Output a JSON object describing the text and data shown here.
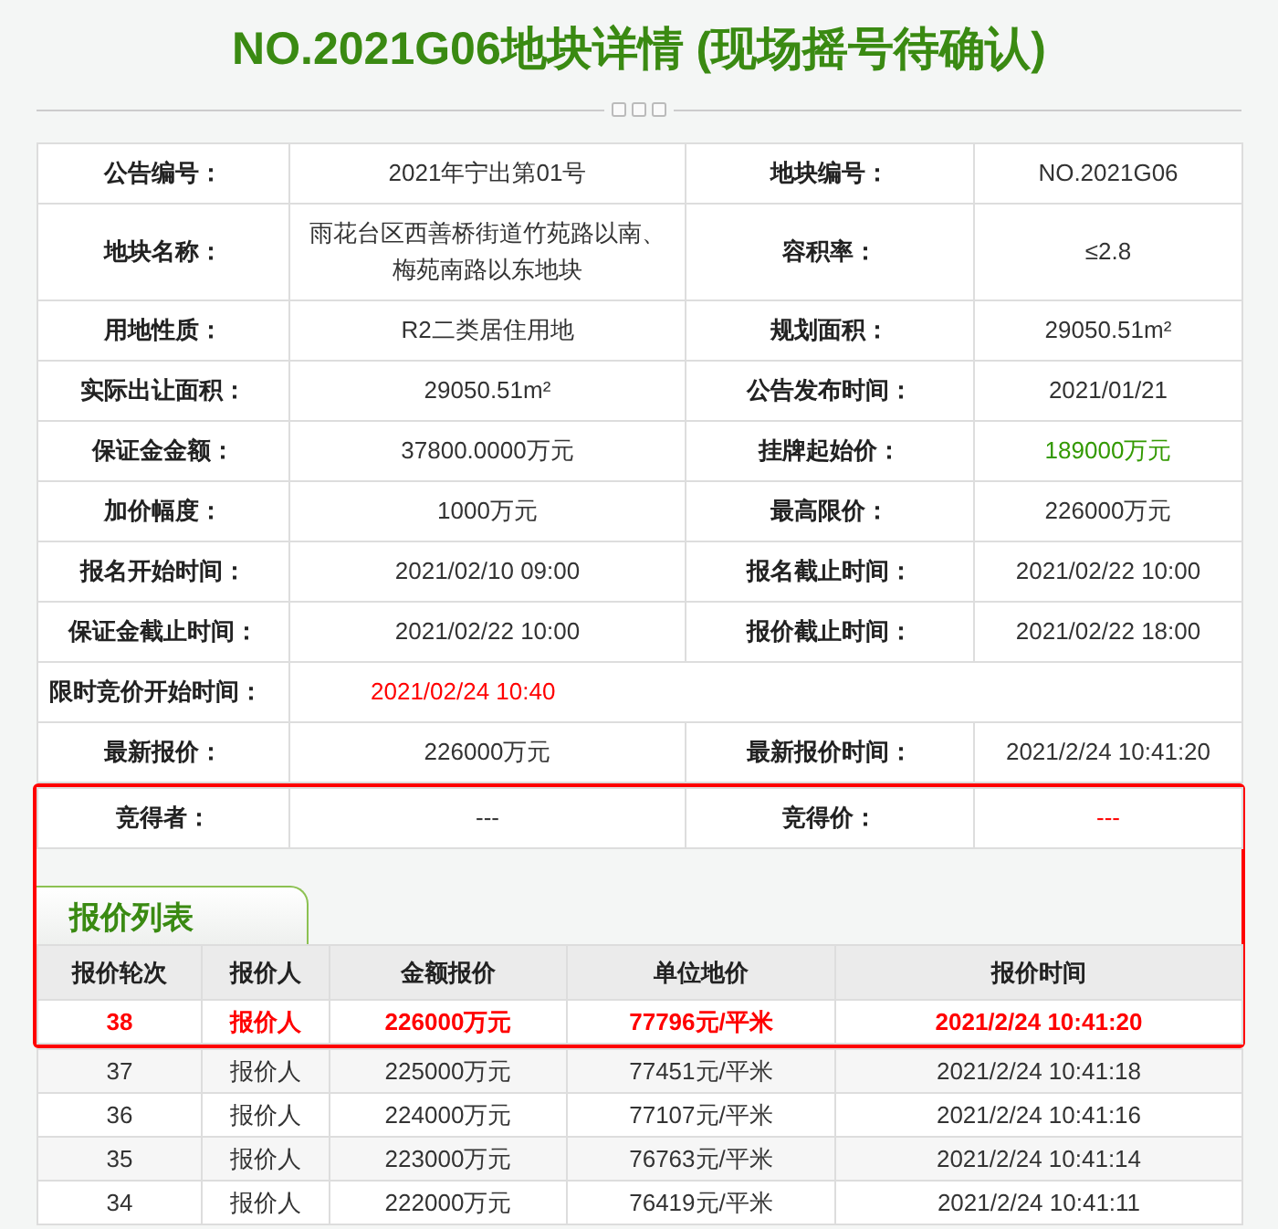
{
  "title": "NO.2021G06地块详情 (现场摇号待确认)",
  "details": [
    {
      "cells": [
        {
          "label": "公告编号：",
          "value": "2021年宁出第01号"
        },
        {
          "label": "地块编号：",
          "value": "NO.2021G06"
        }
      ]
    },
    {
      "cells": [
        {
          "label": "地块名称：",
          "value": "雨花台区西善桥街道竹苑路以南、梅苑南路以东地块"
        },
        {
          "label": "容积率：",
          "value": "≤2.8"
        }
      ]
    },
    {
      "cells": [
        {
          "label": "用地性质：",
          "value": "R2二类居住用地"
        },
        {
          "label": "规划面积：",
          "value": "29050.51m²"
        }
      ]
    },
    {
      "cells": [
        {
          "label": "实际出让面积：",
          "value": "29050.51m²"
        },
        {
          "label": "公告发布时间：",
          "value": "2021/01/21"
        }
      ]
    },
    {
      "cells": [
        {
          "label": "保证金金额：",
          "value": "37800.0000万元"
        },
        {
          "label": "挂牌起始价：",
          "value": "189000万元",
          "color": "#339900"
        }
      ]
    },
    {
      "cells": [
        {
          "label": "加价幅度：",
          "value": "1000万元"
        },
        {
          "label": "最高限价：",
          "value": "226000万元"
        }
      ]
    },
    {
      "cells": [
        {
          "label": "报名开始时间：",
          "value": "2021/02/10 09:00"
        },
        {
          "label": "报名截止时间：",
          "value": "2021/02/22 10:00"
        }
      ]
    },
    {
      "cells": [
        {
          "label": "保证金截止时间：",
          "value": "2021/02/22 10:00"
        },
        {
          "label": "报价截止时间：",
          "value": "2021/02/22 18:00"
        }
      ]
    },
    {
      "cells": [
        {
          "label": "限时竞价开始时间：",
          "value": "2021/02/24 10:40",
          "color": "#ff0000"
        }
      ]
    },
    {
      "cells": [
        {
          "label": "最新报价：",
          "value": "226000万元"
        },
        {
          "label": "最新报价时间：",
          "value": "2021/2/24 10:41:20"
        }
      ]
    }
  ],
  "result": {
    "cells": [
      {
        "label": "竞得者：",
        "value": "---"
      },
      {
        "label": "竞得价：",
        "value": "---",
        "color": "#ff0000"
      }
    ]
  },
  "bids": {
    "tab": "报价列表",
    "columns": [
      "报价轮次",
      "报价人",
      "金额报价",
      "单位地价",
      "报价时间"
    ],
    "rows": [
      {
        "cells": [
          "38",
          "报价人",
          "226000万元",
          "77796元/平米",
          "2021/2/24 10:41:20"
        ],
        "highlighted": true
      },
      {
        "cells": [
          "37",
          "报价人",
          "225000万元",
          "77451元/平米",
          "2021/2/24 10:41:18"
        ],
        "highlighted": false
      },
      {
        "cells": [
          "36",
          "报价人",
          "224000万元",
          "77107元/平米",
          "2021/2/24 10:41:16"
        ],
        "highlighted": false
      },
      {
        "cells": [
          "35",
          "报价人",
          "223000万元",
          "76763元/平米",
          "2021/2/24 10:41:14"
        ],
        "highlighted": false
      },
      {
        "cells": [
          "34",
          "报价人",
          "222000万元",
          "76419元/平米",
          "2021/2/24 10:41:11"
        ],
        "highlighted": false
      }
    ]
  }
}
